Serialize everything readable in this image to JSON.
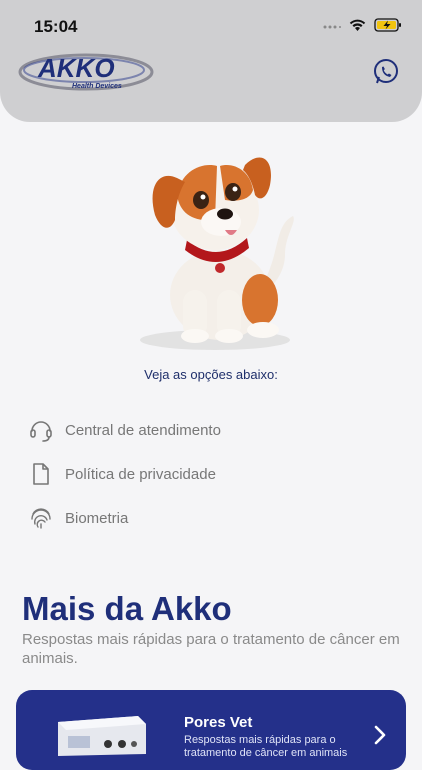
{
  "status_bar": {
    "time": "15:04"
  },
  "header": {
    "logo_text": "AKKO",
    "logo_tagline": "Health Devices"
  },
  "intro": {
    "hint": "Veja as opções abaixo:"
  },
  "menu": [
    {
      "label": "Central de atendimento",
      "icon": "headset-icon"
    },
    {
      "label": "Política de privacidade",
      "icon": "document-icon"
    },
    {
      "label": "Biometria",
      "icon": "fingerprint-icon"
    }
  ],
  "section": {
    "title": "Mais da Akko",
    "subtitle": "Respostas mais rápidas para o tratamento de câncer em animais."
  },
  "card": {
    "title": "Pores Vet",
    "description": "Respostas mais rápidas para o tratamento de câncer em animais"
  },
  "colors": {
    "accent": "#1f2f7a",
    "card_bg": "#24308a",
    "header_bg": "#cfcfd1"
  }
}
